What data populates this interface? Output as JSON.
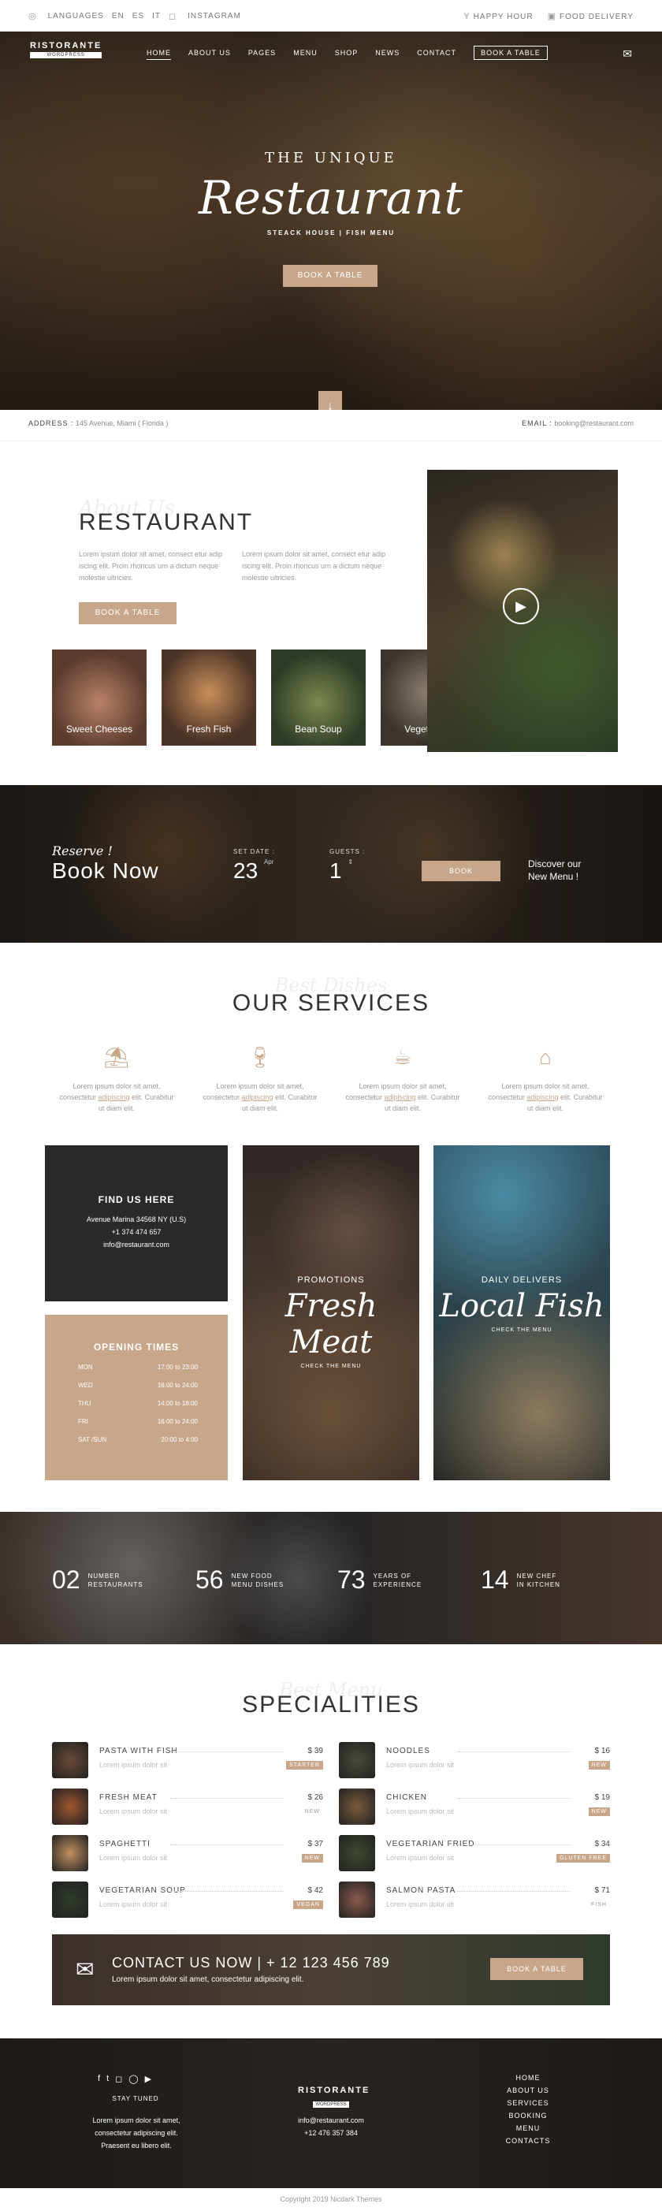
{
  "topbar": {
    "languages": "LANGUAGES",
    "lang": [
      "EN",
      "ES",
      "IT"
    ],
    "instagram": "INSTAGRAM",
    "happy_hour": "HAPPY HOUR",
    "delivery": "FOOD DELIVERY"
  },
  "logo": {
    "title": "RISTORANTE",
    "tagline": "WORDPRESS"
  },
  "nav": {
    "items": [
      "HOME",
      "ABOUT US",
      "PAGES",
      "MENU",
      "SHOP",
      "NEWS",
      "CONTACT"
    ],
    "cta": "BOOK A TABLE"
  },
  "hero": {
    "subtitle": "THE UNIQUE",
    "title": "Restaurant",
    "tagline": "STEACK HOUSE | FISH MENU",
    "button": "BOOK A TABLE"
  },
  "address": {
    "label": "ADDRESS :",
    "value": "145 Avenue, Miami ( Florida )",
    "email_label": "EMAIL :",
    "email": "booking@restaurant.com"
  },
  "about": {
    "watermark": "About Us",
    "title": "RESTAURANT",
    "p1": "Lorem ipsum dolor sit amet, consect etur adip iscing elit. Proin rhoncus urn a dictum neque molestie ultricies.",
    "p2": "Lorem ipsum dolor sit amet, consect etur adip iscing elit. Proin rhoncus urn a dictum neque molestie ultricies.",
    "button": "BOOK A TABLE",
    "thumbs": [
      "Sweet Cheeses",
      "Fresh Fish",
      "Bean Soup",
      "Vegetables"
    ]
  },
  "reserve": {
    "script": "Reserve !",
    "title": "Book Now",
    "date_label": "SET DATE :",
    "date_value": "23",
    "date_unit": "Apr",
    "guests_label": "GUESTS :",
    "guests_value": "1",
    "button": "BOOK",
    "discover": "Discover our",
    "new_menu": "New Menu !"
  },
  "services": {
    "watermark": "Best Dishes",
    "title": "OUR SERVICES",
    "items": [
      {
        "icon": "table-icon",
        "text": "Lorem ipsum dolor sit amet, consectetur",
        "link": "adipiscing",
        "rest": "elit. Curabitur ut diam elit."
      },
      {
        "icon": "wine-glass-icon",
        "text": "Lorem ipsum dolor sit amet, consectetur",
        "link": "adipiscing",
        "rest": "elit. Curabitur ut diam elit."
      },
      {
        "icon": "coffee-machine-icon",
        "text": "Lorem ipsum dolor sit amet, consectetur",
        "link": "adipiscing",
        "rest": "elit. Curabitur ut diam elit."
      },
      {
        "icon": "cake-icon",
        "text": "Lorem ipsum dolor sit amet, consectetur",
        "link": "adipiscing",
        "rest": "elit. Curabitur ut diam elit."
      }
    ]
  },
  "find": {
    "title": "FIND US HERE",
    "address": "Avenue Marina 34568 NY (U.S)",
    "phone": "+1 374 474 657",
    "email": "info@restaurant.com"
  },
  "hours": {
    "title": "OPENING TIMES",
    "rows": [
      [
        "MON",
        "17:00 to 23:00"
      ],
      [
        "WED",
        "16:00 to 24:00"
      ],
      [
        "THU",
        "14:00 to 18:00"
      ],
      [
        "FRI",
        "16:00 to 24:00"
      ],
      [
        "SAT /SUN",
        "20:00 to 4:00"
      ]
    ]
  },
  "promo": {
    "kicker": "PROMOTIONS",
    "title": "Fresh Meat",
    "link": "CHECK THE MENU"
  },
  "daily": {
    "kicker": "DAILY DELIVERS",
    "title": "Local Fish",
    "link": "CHECK THE MENU"
  },
  "counters": [
    {
      "n": "02",
      "l1": "NUMBER",
      "l2": "RESTAURANTS"
    },
    {
      "n": "56",
      "l1": "NEW FOOD",
      "l2": "MENU DISHES"
    },
    {
      "n": "73",
      "l1": "YEARS OF",
      "l2": "EXPERIENCE"
    },
    {
      "n": "14",
      "l1": "NEW CHEF",
      "l2": "IN KITCHEN"
    }
  ],
  "spec": {
    "watermark": "Best Menu",
    "title": "SPECIALITIES",
    "items": [
      {
        "name": "PASTA WITH FISH",
        "desc": "Lorem ipsum dolor sit",
        "price": "$ 39",
        "tag": "STARTER",
        "plain": false
      },
      {
        "name": "NOODLES",
        "desc": "Lorem ipsum dolor sit",
        "price": "$ 16",
        "tag": "NEW",
        "plain": false
      },
      {
        "name": "FRESH MEAT",
        "desc": "Lorem ipsum dolor sit",
        "price": "$ 26",
        "tag": "NEW",
        "plain": true
      },
      {
        "name": "CHICKEN",
        "desc": "Lorem ipsum dolor sit",
        "price": "$ 19",
        "tag": "NEW",
        "plain": false
      },
      {
        "name": "SPAGHETTI",
        "desc": "Lorem ipsum dolor sit",
        "price": "$ 37",
        "tag": "NEW",
        "plain": false
      },
      {
        "name": "VEGETARIAN FRIED",
        "desc": "Lorem ipsum dolor sit",
        "price": "$ 34",
        "tag": "GLUTEN FREE",
        "plain": false
      },
      {
        "name": "VEGETARIAN SOUP",
        "desc": "Lorem ipsum dolor sit",
        "price": "$ 42",
        "tag": "VEGAN",
        "plain": false
      },
      {
        "name": "SALMON PASTA",
        "desc": "Lorem ipsum dolor sit",
        "price": "$ 71",
        "tag": "FISH",
        "plain": true
      }
    ]
  },
  "contact": {
    "title": "CONTACT US NOW |",
    "phone": "+ 12 123 456 789",
    "sub": "Lorem ipsum dolor sit amet, consectetur adipiscing elit.",
    "button": "BOOK A TABLE"
  },
  "footer": {
    "stay": "STAY TUNED",
    "text": "Lorem ipsum dolor sit amet, consectetur adipiscing elit. Praesent eu libero elit.",
    "email": "info@restaurant.com",
    "phone": "+12 476 357 384",
    "links": [
      "HOME",
      "ABOUT US",
      "SERVICES",
      "BOOKING",
      "MENU",
      "CONTACTS"
    ]
  },
  "copyright": "Copyright 2019 Nicdark Themes"
}
